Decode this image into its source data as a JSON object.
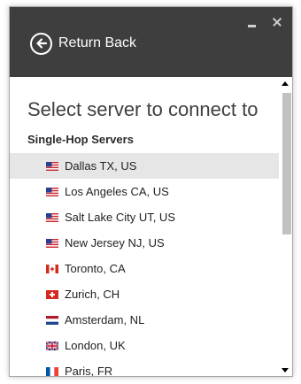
{
  "header": {
    "return_label": "Return Back"
  },
  "main": {
    "heading": "Select server to connect to",
    "section_label": "Single-Hop Servers",
    "selected_index": 0,
    "servers": [
      {
        "name": "Dallas TX, US",
        "flag": "us-flag-icon"
      },
      {
        "name": "Los Angeles CA, US",
        "flag": "us-flag-icon"
      },
      {
        "name": "Salt Lake City UT, US",
        "flag": "us-flag-icon"
      },
      {
        "name": "New Jersey NJ, US",
        "flag": "us-flag-icon"
      },
      {
        "name": "Toronto, CA",
        "flag": "canada-flag-icon"
      },
      {
        "name": "Zurich, CH",
        "flag": "switzerland-flag-icon"
      },
      {
        "name": "Amsterdam, NL",
        "flag": "netherlands-flag-icon"
      },
      {
        "name": "London, UK",
        "flag": "uk-flag-icon"
      },
      {
        "name": "Paris, FR",
        "flag": "france-flag-icon"
      }
    ]
  },
  "colors": {
    "titlebar": "#3e3e3e",
    "selected_row": "#e6e6e6",
    "scroll_thumb": "#c2c2c2"
  }
}
